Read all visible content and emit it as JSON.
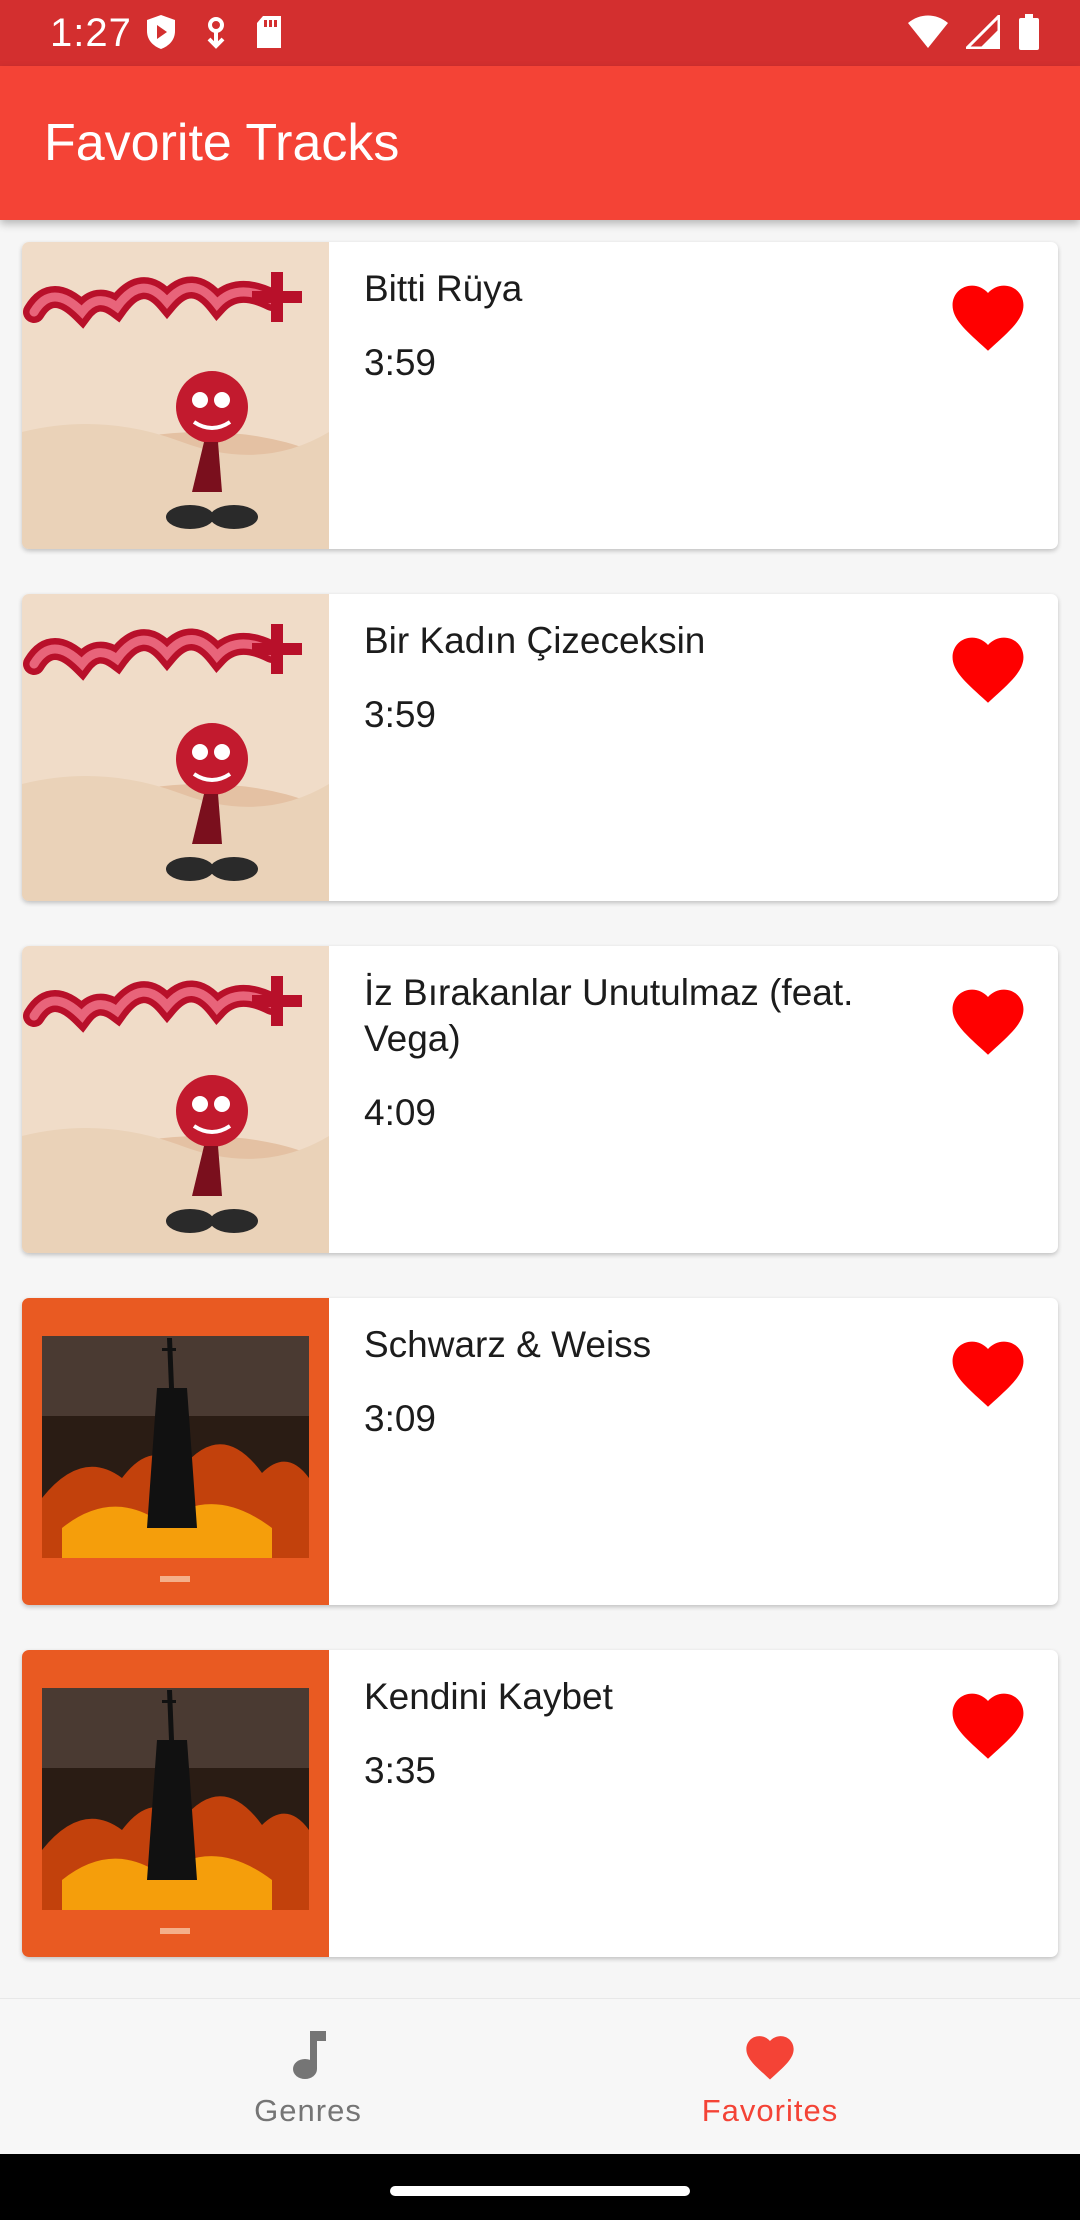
{
  "status_bar": {
    "time": "1:27",
    "left_icons": [
      "play-protect-icon",
      "download-icon",
      "sd-card-icon"
    ],
    "right_icons": [
      "wifi-icon",
      "signal-icon",
      "battery-icon"
    ],
    "color": "#d32f2f"
  },
  "app_bar": {
    "title": "Favorite Tracks",
    "color": "#f44336"
  },
  "tracks": [
    {
      "title": "Bitti Rüya",
      "duration": "3:59",
      "cover": "manga-cover",
      "favorite": true
    },
    {
      "title": "Bir Kadın Çizeceksin",
      "duration": "3:59",
      "cover": "manga-cover",
      "favorite": true
    },
    {
      "title": "İz Bırakanlar Unutulmaz (feat. Vega)",
      "duration": "4:09",
      "cover": "manga-cover",
      "favorite": true
    },
    {
      "title": "Schwarz & Weiss",
      "duration": "3:09",
      "cover": "fire-cover",
      "favorite": true
    },
    {
      "title": "Kendini Kaybet",
      "duration": "3:35",
      "cover": "fire-cover",
      "favorite": true
    }
  ],
  "favorite_icon": "heart-icon",
  "favorite_color": "#ff0000",
  "bottom_nav": {
    "items": [
      {
        "label": "Genres",
        "icon": "music-note-icon",
        "selected": false
      },
      {
        "label": "Favorites",
        "icon": "heart-icon",
        "selected": true
      }
    ],
    "selected_color": "#f44336",
    "unselected_color": "#757575"
  }
}
